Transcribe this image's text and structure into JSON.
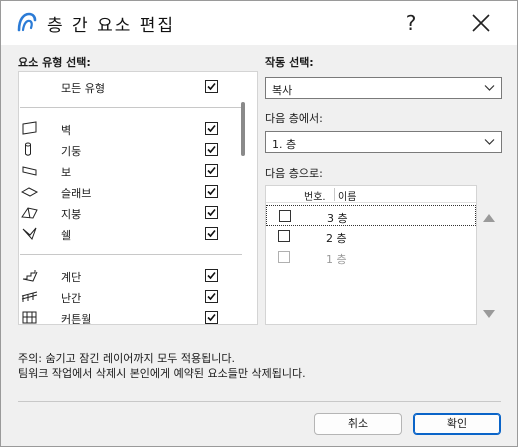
{
  "window": {
    "title": "층 간 요소 편집",
    "help_label": "?"
  },
  "left_panel": {
    "label": "요소 유형 선택:",
    "all_types": {
      "label": "모든 유형",
      "checked": true
    },
    "group1": [
      {
        "label": "벽",
        "icon": "wall-icon",
        "checked": true
      },
      {
        "label": "기둥",
        "icon": "column-icon",
        "checked": true
      },
      {
        "label": "보",
        "icon": "beam-icon",
        "checked": true
      },
      {
        "label": "슬래브",
        "icon": "slab-icon",
        "checked": true
      },
      {
        "label": "지붕",
        "icon": "roof-icon",
        "checked": true
      },
      {
        "label": "쉘",
        "icon": "shell-icon",
        "checked": true
      }
    ],
    "group2": [
      {
        "label": "계단",
        "icon": "stair-icon",
        "checked": true
      },
      {
        "label": "난간",
        "icon": "railing-icon",
        "checked": true
      },
      {
        "label": "커튼월",
        "icon": "curtain-wall-icon",
        "checked": true
      }
    ]
  },
  "right_panel": {
    "action_label": "작동 선택:",
    "action_value": "복사",
    "from_label": "다음 층에서:",
    "from_value": "1. 층",
    "to_label": "다음 층으로:",
    "columns": {
      "number": "번호.",
      "name": "이름"
    },
    "stories": [
      {
        "name": "3 층",
        "checked": false,
        "enabled": true,
        "focused": true
      },
      {
        "name": "2 층",
        "checked": false,
        "enabled": true,
        "focused": false
      },
      {
        "name": "1 층",
        "checked": false,
        "enabled": false,
        "focused": false
      }
    ]
  },
  "notes": {
    "line1": "주의: 숨기고 잠긴 레이어까지 모두 적용됩니다.",
    "line2": "팀워크 작업에서 삭제시 본인에게 예약된 요소들만 삭제됩니다."
  },
  "buttons": {
    "cancel": "취소",
    "ok": "확인"
  },
  "colors": {
    "accent": "#0a64c8",
    "app_icon": "#2b7bd6"
  }
}
